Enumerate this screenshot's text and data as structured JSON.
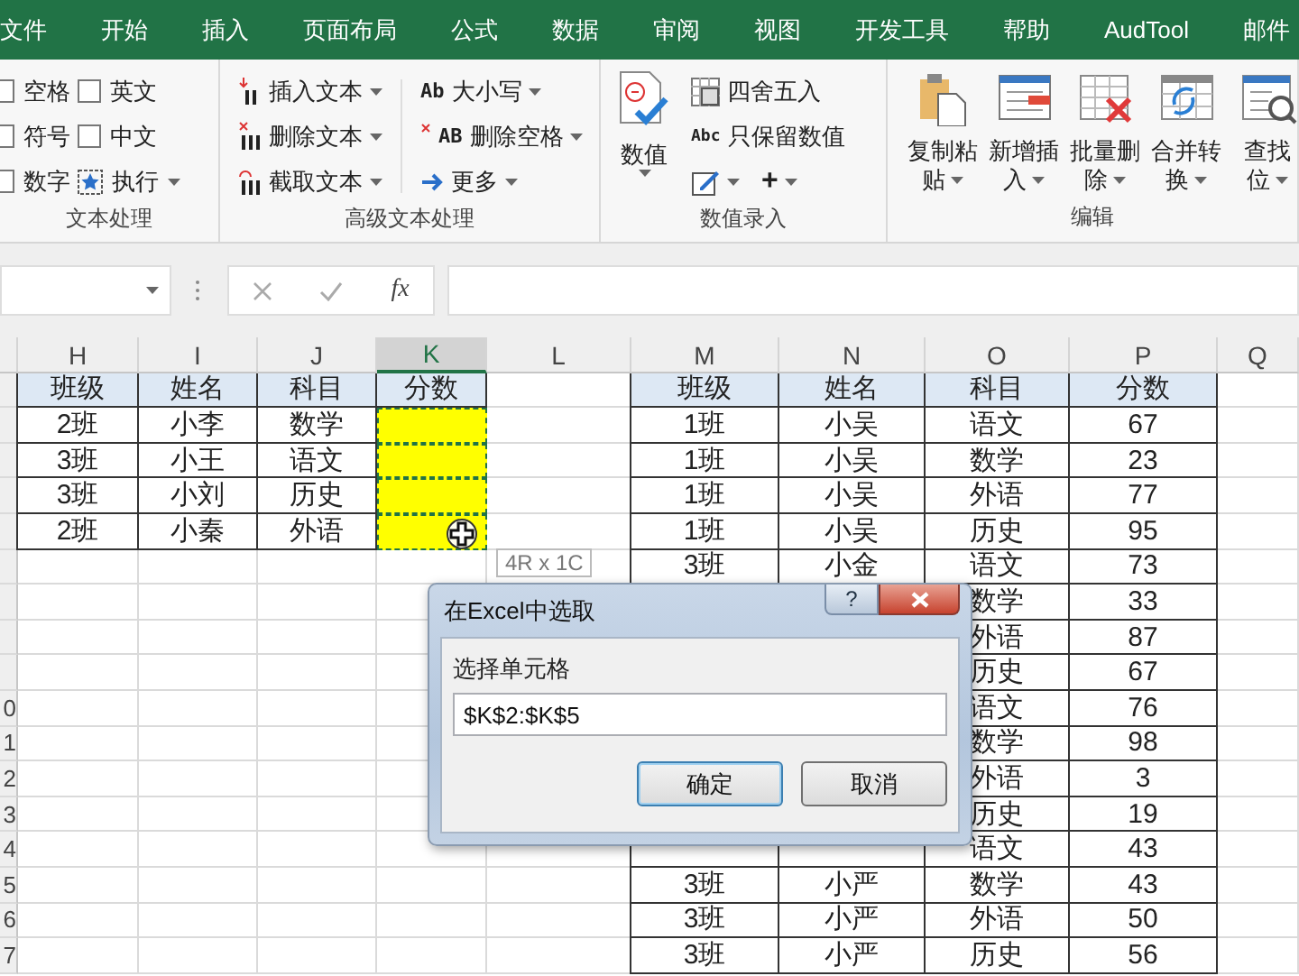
{
  "menu": [
    {
      "label": "文件"
    },
    {
      "label": "开始"
    },
    {
      "label": "插入"
    },
    {
      "label": "页面布局"
    },
    {
      "label": "公式"
    },
    {
      "label": "数据"
    },
    {
      "label": "审阅"
    },
    {
      "label": "视图"
    },
    {
      "label": "开发工具"
    },
    {
      "label": "帮助"
    },
    {
      "label": "AudTool"
    },
    {
      "label": "邮件"
    }
  ],
  "ribbon": {
    "groups": [
      {
        "kind": "checkboxes",
        "label": "文本处理",
        "checkboxes": [
          {
            "label": "空格",
            "checked": false
          },
          {
            "label": "符号",
            "checked": false
          },
          {
            "label": "数字",
            "checked": false
          },
          {
            "label": "英文",
            "checked": false
          },
          {
            "label": "中文",
            "checked": false
          }
        ],
        "run_button": {
          "label": "执行"
        }
      },
      {
        "kind": "text_tools",
        "label": "高级文本处理",
        "items": [
          {
            "label": "插入文本"
          },
          {
            "label": "删除文本"
          },
          {
            "label": "截取文本"
          },
          {
            "label": "大小写",
            "icon_text": "Ab"
          },
          {
            "label": "删除空格",
            "icon_text": "AB"
          },
          {
            "label": "更多"
          }
        ]
      },
      {
        "kind": "number_tools",
        "label": "数值录入",
        "big_button": {
          "label": "数值"
        },
        "items": [
          {
            "label": "四舍五入"
          },
          {
            "label": "只保留数值",
            "icon_text": "Abc"
          }
        ],
        "small_buttons": [
          {
            "kind": "icon"
          },
          {
            "kind": "symbol",
            "text": "+"
          }
        ]
      },
      {
        "kind": "big_buttons",
        "label": "编辑",
        "buttons": [
          {
            "lines": [
              "复制粘",
              "贴"
            ]
          },
          {
            "lines": [
              "新增插",
              "入"
            ]
          },
          {
            "lines": [
              "批量删",
              "除"
            ]
          },
          {
            "lines": [
              "合并转",
              "换"
            ]
          },
          {
            "lines": [
              "查找",
              "位"
            ]
          }
        ]
      }
    ]
  },
  "formula_bar": {
    "fx": "fx"
  },
  "columns": [
    {
      "label": "H",
      "selected": false
    },
    {
      "label": "I",
      "selected": false
    },
    {
      "label": "J",
      "selected": false
    },
    {
      "label": "K",
      "selected": true
    },
    {
      "label": "L",
      "selected": false
    },
    {
      "label": "M",
      "selected": false
    },
    {
      "label": "N",
      "selected": false
    },
    {
      "label": "O",
      "selected": false
    },
    {
      "label": "P",
      "selected": false
    },
    {
      "label": "Q",
      "selected": false
    }
  ],
  "row_numbers_tail": [
    "0",
    "1",
    "2",
    "3",
    "4",
    "5",
    "6",
    "7"
  ],
  "left_table": {
    "header": [
      "班级",
      "姓名",
      "科目",
      "分数"
    ],
    "rows": [
      {
        "cells": [
          "2班",
          "小李",
          "数学"
        ],
        "marked": true,
        "pointer": false
      },
      {
        "cells": [
          "3班",
          "小王",
          "语文"
        ],
        "marked": true,
        "pointer": false
      },
      {
        "cells": [
          "3班",
          "小刘",
          "历史"
        ],
        "marked": true,
        "pointer": false
      },
      {
        "cells": [
          "2班",
          "小秦",
          "外语"
        ],
        "marked": true,
        "pointer": true
      }
    ]
  },
  "right_table": {
    "header": [
      "班级",
      "姓名",
      "科目",
      "分数"
    ],
    "rows": [
      [
        "1班",
        "小吴",
        "语文",
        "67"
      ],
      [
        "1班",
        "小吴",
        "数学",
        "23"
      ],
      [
        "1班",
        "小吴",
        "外语",
        "77"
      ],
      [
        "1班",
        "小吴",
        "历史",
        "95"
      ],
      [
        "3班",
        "小金",
        "语文",
        "73"
      ],
      [
        null,
        null,
        "数学",
        "33"
      ],
      [
        null,
        null,
        "外语",
        "87"
      ],
      [
        null,
        null,
        "历史",
        "67"
      ],
      [
        null,
        null,
        "语文",
        "76"
      ],
      [
        null,
        null,
        "数学",
        "98"
      ],
      [
        null,
        null,
        "外语",
        "3"
      ],
      [
        null,
        null,
        "历史",
        "19"
      ],
      [
        null,
        null,
        "语文",
        "43"
      ],
      [
        "3班",
        "小严",
        "数学",
        "43"
      ],
      [
        "3班",
        "小严",
        "外语",
        "50"
      ],
      [
        "3班",
        "小严",
        "历史",
        "56"
      ]
    ]
  },
  "tooltip": "4R x 1C",
  "dialog": {
    "title": "在Excel中选取",
    "help": "?",
    "field_label": "选择单元格",
    "value": "$K$2:$K$5",
    "buttons": [
      {
        "label": "确定",
        "selected": true
      },
      {
        "label": "取消",
        "selected": false
      }
    ]
  }
}
